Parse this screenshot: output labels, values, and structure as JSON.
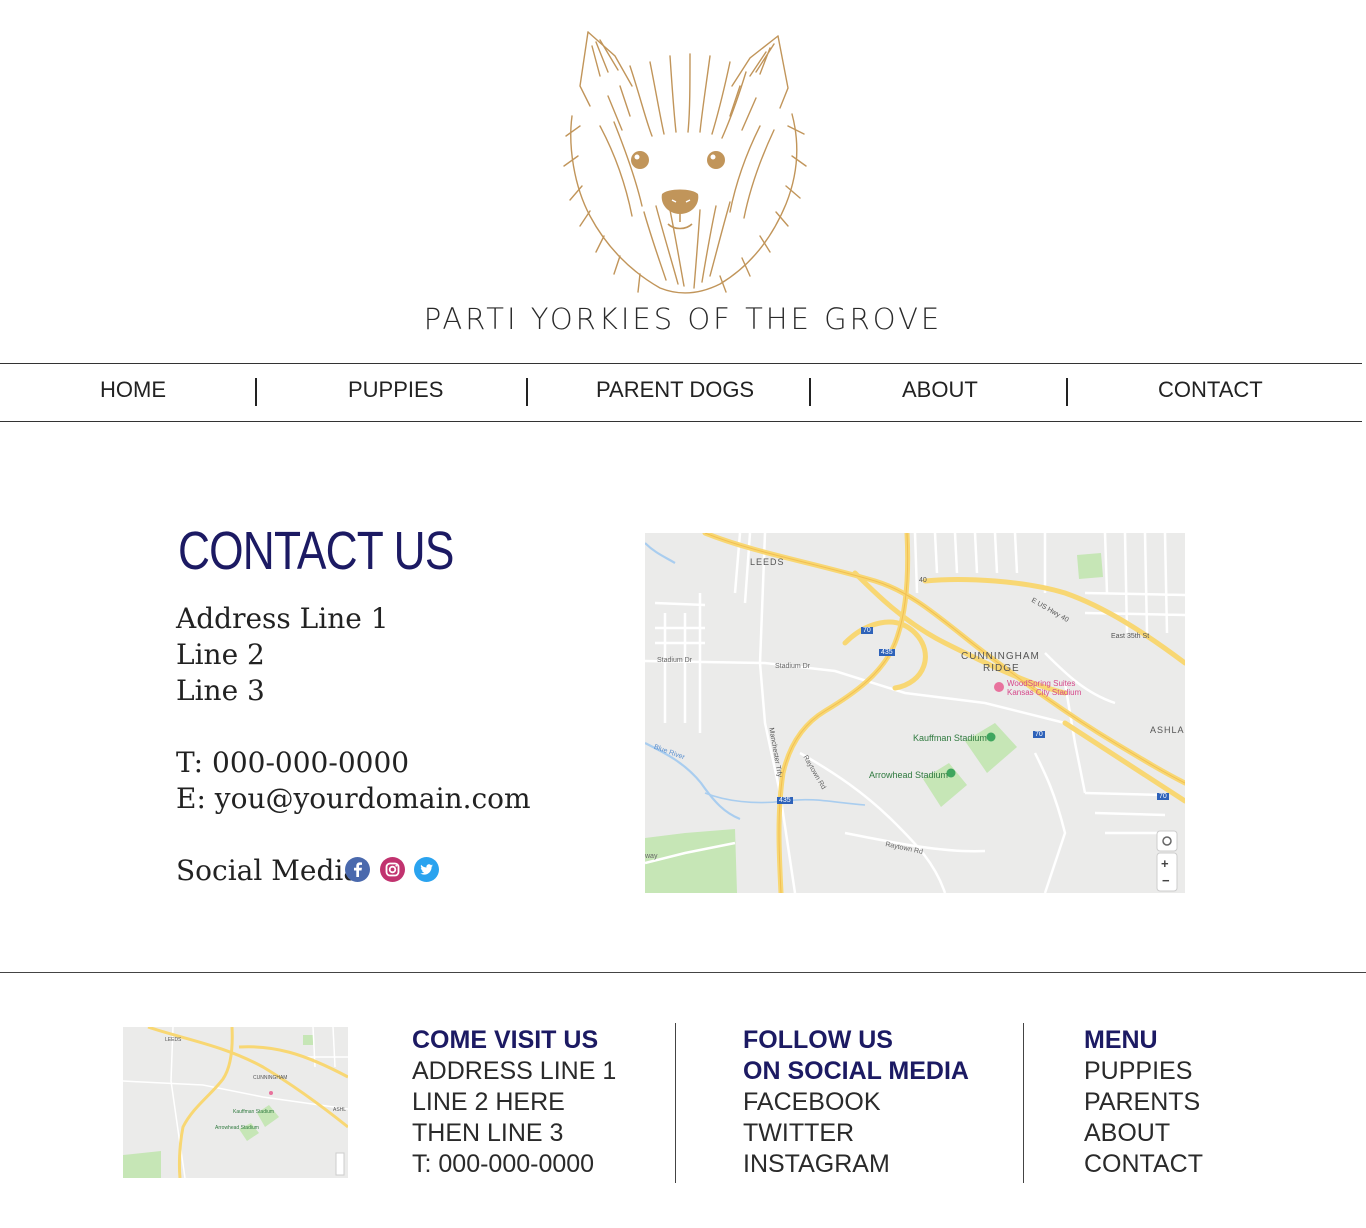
{
  "brand": {
    "name": "PARTI YORKIES OF THE GROVE",
    "accent": "#c1955a"
  },
  "nav": {
    "items": [
      "HOME",
      "PUPPIES",
      "PARENT DOGS",
      "ABOUT",
      "CONTACT"
    ]
  },
  "contact": {
    "title": "CONTACT US",
    "address": [
      "Address Line 1",
      "Line 2",
      "Line 3"
    ],
    "phone": "T: 000-000-0000",
    "email": "E: you@yourdomain.com",
    "social_label": "Social Media",
    "social_icons": [
      "facebook-icon",
      "instagram-icon",
      "twitter-icon"
    ],
    "title_color": "#1c1a63"
  },
  "map": {
    "labels": {
      "leeds": "LEEDS",
      "cunningham": "CUNNINGHAM",
      "ridge": "RIDGE",
      "woodspring": "WoodSpring Suites",
      "kc_stadium": "Kansas City Stadium",
      "kauffman": "Kauffman Stadium",
      "arrowhead": "Arrowhead Stadium",
      "ashland": "ASHLA",
      "stadium_dr_left": "Stadium Dr",
      "stadium_dr": "Stadium Dr",
      "blue_river": "Blue River",
      "raytown_rd": "Raytown Rd",
      "raytown_rd2": "Raytown Rd",
      "us40": "E US Hwy 40",
      "e35th": "East 35th St",
      "manchester": "Manchester Trfy",
      "hwy40": "40",
      "i70a": "70",
      "i435a": "435",
      "i70b": "70",
      "i435b": "435",
      "i70c": "70",
      "way": "way"
    },
    "controls": {
      "zoom_in": "+",
      "zoom_out": "−"
    }
  },
  "footer": {
    "visit": {
      "heading": "COME VISIT US",
      "lines": [
        "ADDRESS LINE 1",
        "LINE 2 HERE",
        "THEN LINE 3",
        "T: 000-000-0000"
      ]
    },
    "follow": {
      "heading1": "FOLLOW US",
      "heading2": "ON SOCIAL MEDIA",
      "links": [
        "FACEBOOK",
        "TWITTER",
        "INSTAGRAM"
      ]
    },
    "menu": {
      "heading": "MENU",
      "links": [
        "PUPPIES",
        "PARENTS",
        "ABOUT",
        "CONTACT"
      ]
    },
    "mini_map": {
      "leeds": "LEEDS",
      "cunningham": "CUNNINGHAM",
      "kauffman": "Kauffman Stadium",
      "arrowhead": "Arrowhead Stadium",
      "ashland": "ASHL"
    }
  }
}
